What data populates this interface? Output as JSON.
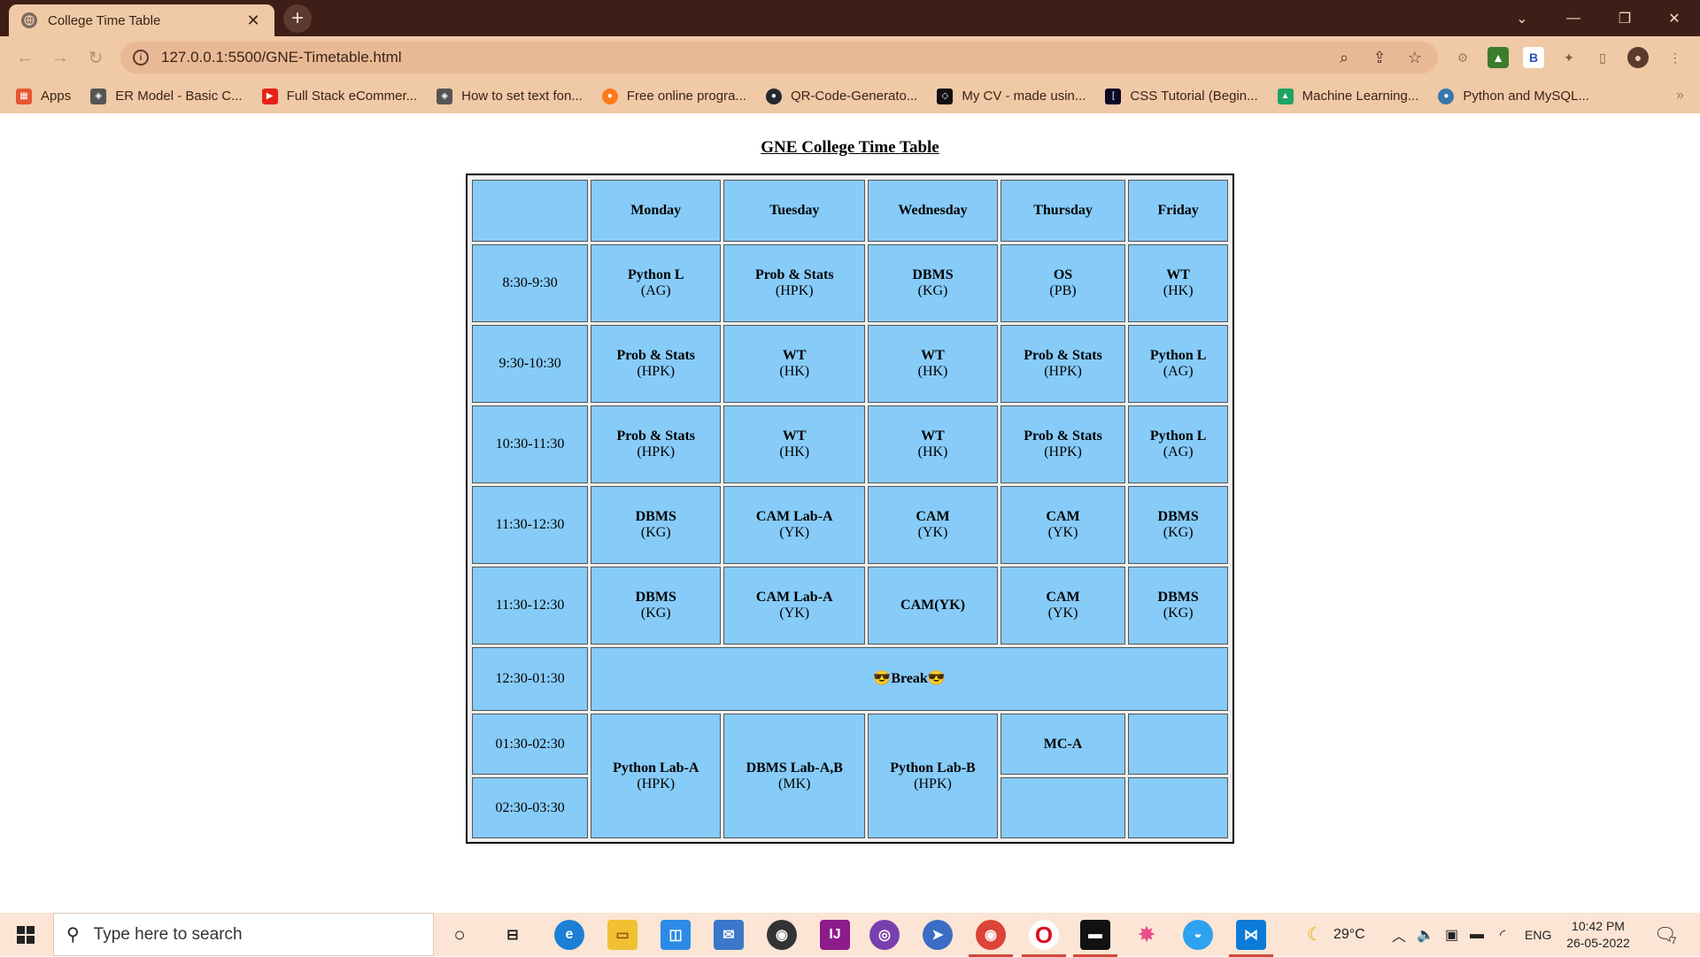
{
  "browser": {
    "tab_title": "College Time Table",
    "url": "127.0.0.1:5500/GNE-Timetable.html",
    "bookmarks": [
      {
        "label": "Apps",
        "icon": "apps-grid-icon",
        "color": "#e6562f"
      },
      {
        "label": "ER Model - Basic C...",
        "icon": "geeks-icon",
        "color": "#555555"
      },
      {
        "label": "Full Stack eCommer...",
        "icon": "youtube-icon",
        "color": "#e62117"
      },
      {
        "label": "How to set text fon...",
        "icon": "geeks-icon",
        "color": "#555555"
      },
      {
        "label": "Free online progra...",
        "icon": "firefox-icon",
        "color": "#ff7a1a"
      },
      {
        "label": "QR-Code-Generato...",
        "icon": "github-icon",
        "color": "#24292e"
      },
      {
        "label": "My CV - made usin...",
        "icon": "codepen-icon",
        "color": "#111111"
      },
      {
        "label": "CSS Tutorial (Begin...",
        "icon": "freecodecamp-icon",
        "color": "#0a0a23"
      },
      {
        "label": "Machine Learning...",
        "icon": "google-drive-icon",
        "color": "#1fa463"
      },
      {
        "label": "Python and MySQL...",
        "icon": "python-icon",
        "color": "#3776ab"
      }
    ]
  },
  "page": {
    "heading": "GNE College Time Table"
  },
  "timetable": {
    "days": [
      "Monday",
      "Tuesday",
      "Wednesday",
      "Thursday",
      "Friday"
    ],
    "rows": [
      {
        "time": "8:30-9:30",
        "cells": [
          {
            "subject": "Python L",
            "prof": "(AG)"
          },
          {
            "subject": "Prob & Stats",
            "prof": "(HPK)"
          },
          {
            "subject": "DBMS",
            "prof": "(KG)"
          },
          {
            "subject": "OS",
            "prof": "(PB)"
          },
          {
            "subject": "WT",
            "prof": "(HK)"
          }
        ]
      },
      {
        "time": "9:30-10:30",
        "cells": [
          {
            "subject": "Prob & Stats",
            "prof": "(HPK)"
          },
          {
            "subject": "WT",
            "prof": "(HK)"
          },
          {
            "subject": "WT",
            "prof": "(HK)"
          },
          {
            "subject": "Prob & Stats",
            "prof": "(HPK)"
          },
          {
            "subject": "Python L",
            "prof": "(AG)"
          }
        ]
      },
      {
        "time": "10:30-11:30",
        "cells": [
          {
            "subject": "Prob & Stats",
            "prof": "(HPK)"
          },
          {
            "subject": "WT",
            "prof": "(HK)"
          },
          {
            "subject": "WT",
            "prof": "(HK)"
          },
          {
            "subject": "Prob & Stats",
            "prof": "(HPK)"
          },
          {
            "subject": "Python L",
            "prof": "(AG)"
          }
        ]
      },
      {
        "time": "11:30-12:30",
        "cells": [
          {
            "subject": "DBMS",
            "prof": "(KG)"
          },
          {
            "subject": "CAM Lab-A",
            "prof": "(YK)"
          },
          {
            "subject": "CAM",
            "prof": "(YK)"
          },
          {
            "subject": "CAM",
            "prof": "(YK)"
          },
          {
            "subject": "DBMS",
            "prof": "(KG)"
          }
        ]
      },
      {
        "time": "11:30-12:30",
        "cells": [
          {
            "subject": "DBMS",
            "prof": "(KG)"
          },
          {
            "subject": "CAM Lab-A",
            "prof": "(YK)"
          },
          {
            "subject": "CAM(YK)",
            "prof": ""
          },
          {
            "subject": "CAM",
            "prof": "(YK)"
          },
          {
            "subject": "DBMS",
            "prof": "(KG)"
          }
        ]
      }
    ],
    "break_time": "12:30-01:30",
    "break_label": "😎Break😎",
    "afternoon_time_1": "01:30-02:30",
    "afternoon_time_2": "02:30-03:30",
    "afternoon": {
      "monday": {
        "subject": "Python Lab-A",
        "prof": "(HPK)"
      },
      "tuesday": {
        "subject": "DBMS Lab-A,B",
        "prof": "(MK)"
      },
      "wednesday": {
        "subject": "Python Lab-B",
        "prof": "(HPK)"
      },
      "thursday_1": {
        "subject": "MC-A",
        "prof": ""
      }
    }
  },
  "taskbar": {
    "search_placeholder": "Type here to search",
    "weather": "29°C",
    "language": "ENG",
    "time": "10:42 PM",
    "date": "26-05-2022",
    "notification_count": "7"
  },
  "colors": {
    "cell_bg": "#87cbf8",
    "chrome_bg": "#f0c9a6",
    "titlebar_bg": "#3e1e16"
  }
}
